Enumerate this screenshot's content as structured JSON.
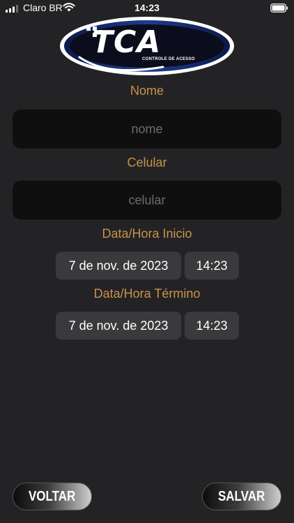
{
  "status_bar": {
    "carrier": "Claro BR",
    "time": "14:23"
  },
  "logo": {
    "text": "TCA",
    "subtitle": "CONTROLE DE ACESSO"
  },
  "form": {
    "name_label": "Nome",
    "name_placeholder": "nome",
    "name_value": "",
    "phone_label": "Celular",
    "phone_placeholder": "celular",
    "phone_value": "",
    "start_label": "Data/Hora Inicio",
    "start_date": "7 de nov. de 2023",
    "start_time": "14:23",
    "end_label": "Data/Hora Término",
    "end_date": "7 de nov. de 2023",
    "end_time": "14:23"
  },
  "buttons": {
    "back": "VOLTAR",
    "save": "SALVAR"
  },
  "colors": {
    "background": "#232325",
    "label_accent": "#c8924a",
    "input_background": "#0f0f10",
    "picker_background": "#3a3a3c"
  }
}
